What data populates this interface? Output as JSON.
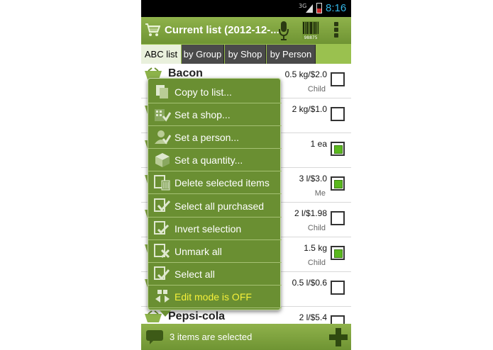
{
  "status_bar": {
    "network": "3G",
    "time": "8:16"
  },
  "action_bar": {
    "title": "Current list (2012-12-...",
    "barcode_text": "98875",
    "icons": [
      "cart-icon",
      "microphone-icon",
      "barcode-icon",
      "overflow-menu-icon"
    ]
  },
  "tabs": [
    {
      "label": "ABC list",
      "active": true
    },
    {
      "label": "by Group",
      "active": false
    },
    {
      "label": "by Shop",
      "active": false
    },
    {
      "label": "by Person",
      "active": false
    }
  ],
  "items": [
    {
      "name": "Bacon",
      "qty": "0.5 kg/$2.0",
      "person": "Child",
      "checked": false
    },
    {
      "name": "",
      "qty": "2 kg/$1.0",
      "person": "",
      "checked": false
    },
    {
      "name": "",
      "qty": "1 ea",
      "person": "",
      "checked": true
    },
    {
      "name": "",
      "qty": "3 l/$3.0",
      "person": "Me",
      "checked": true
    },
    {
      "name": "",
      "qty": "2 l/$1.98",
      "person": "Child",
      "checked": false
    },
    {
      "name": "",
      "qty": "1.5 kg",
      "person": "Child",
      "checked": true
    },
    {
      "name": "",
      "qty": "0.5 l/$0.6",
      "person": "",
      "checked": false
    },
    {
      "name": "Pepsi-cola",
      "qty": "2 l/$5.4",
      "person": "",
      "checked": false
    }
  ],
  "context_menu": [
    {
      "label": "Copy to list...",
      "icon": "copy-icon"
    },
    {
      "label": "Set a shop...",
      "icon": "shop-icon"
    },
    {
      "label": "Set a person...",
      "icon": "person-icon"
    },
    {
      "label": "Set a quantity...",
      "icon": "quantity-icon"
    },
    {
      "label": "Delete selected items",
      "icon": "trash-icon"
    },
    {
      "label": "Select all purchased",
      "icon": "select-purchased-icon"
    },
    {
      "label": "Invert selection",
      "icon": "invert-icon"
    },
    {
      "label": "Unmark all",
      "icon": "unmark-icon"
    },
    {
      "label": "Select all",
      "icon": "select-all-icon"
    },
    {
      "label": "Edit mode is OFF",
      "icon": "edit-mode-icon",
      "highlight": "#f5f03a"
    }
  ],
  "bottom_bar": {
    "status": "3 items are selected"
  },
  "colors": {
    "accent": "#7aa03a",
    "menu_bg": "#6a8f32",
    "highlight_text": "#f5f03a",
    "checkbox_on": "#5ab81e"
  }
}
